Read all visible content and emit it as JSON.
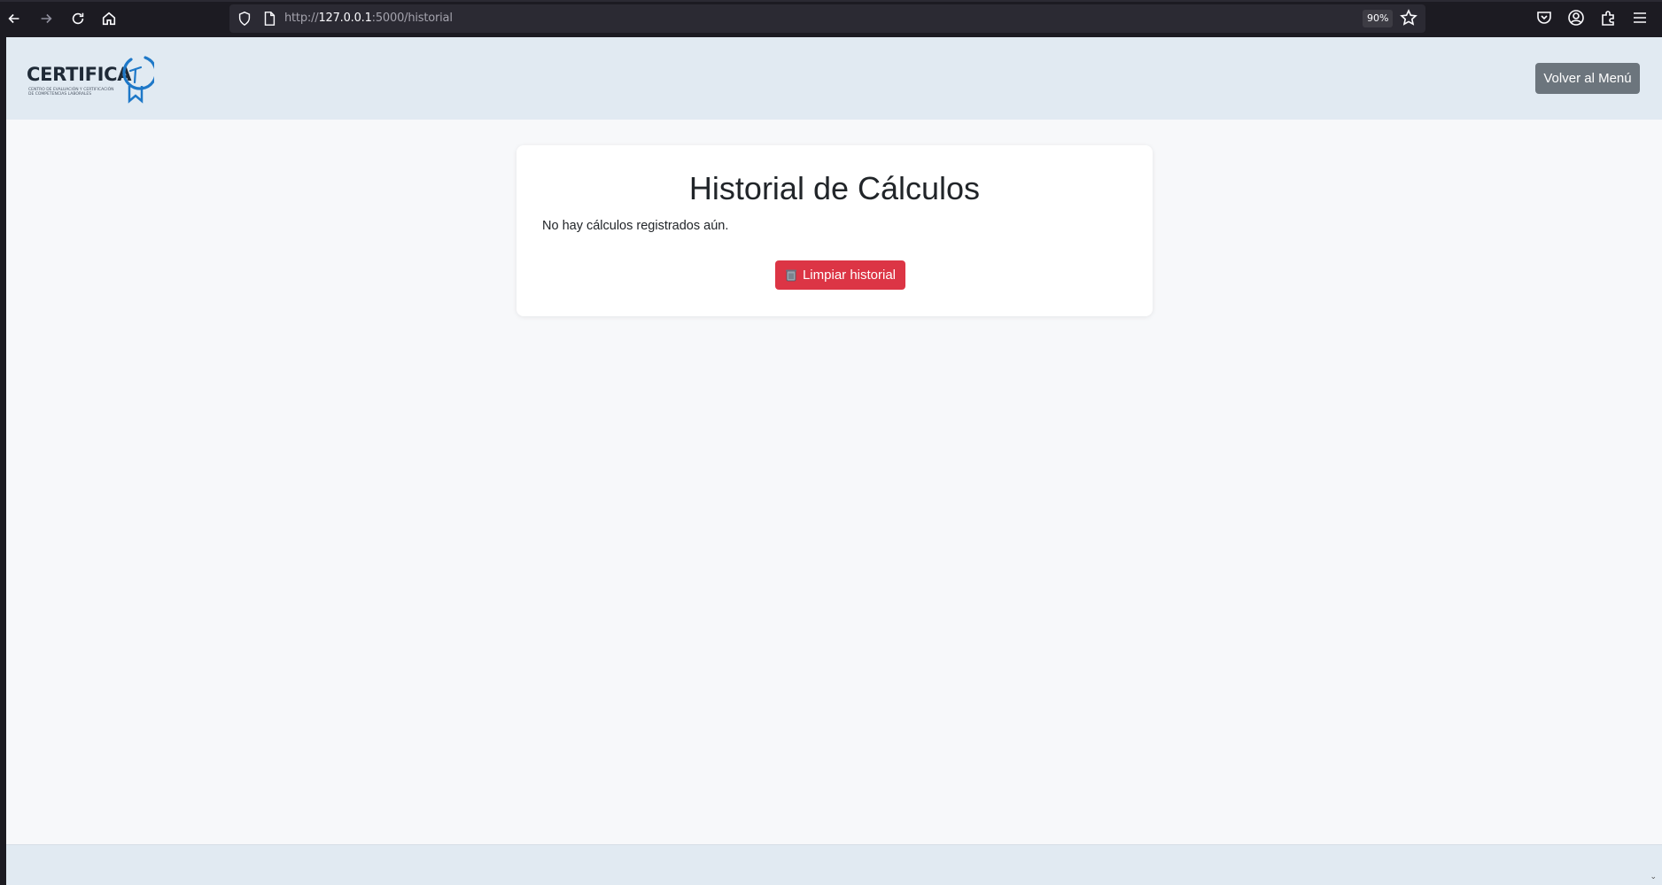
{
  "browser": {
    "url_scheme": "http://",
    "url_host": "127.0.0.1",
    "url_rest": ":5000/historial",
    "zoom": "90%"
  },
  "icons": {
    "back": "back-arrow-icon",
    "forward": "forward-arrow-icon",
    "reload": "reload-icon",
    "home": "home-icon",
    "shield": "shield-icon",
    "page": "page-icon",
    "bookmark": "star-icon",
    "pocket": "pocket-icon",
    "account": "account-icon",
    "extensions": "extensions-icon",
    "menu": "hamburger-menu-icon",
    "trash": "trash-icon"
  },
  "header": {
    "logo_word": "CERTIFICA",
    "logo_tagline": "CENTRO DE EVALUACIÓN Y CERTIFICACIÓN DE COMPETENCIAS LABORALES",
    "back_button": "Volver al Menú"
  },
  "main": {
    "title": "Historial de Cálculos",
    "empty_message": "No hay cálculos registrados aún.",
    "clear_button": "Limpiar historial"
  },
  "colors": {
    "header_bg": "#e1eaf2",
    "page_bg": "#f7f8fa",
    "danger": "#dc3545",
    "secondary": "#6c757d",
    "logo_accent": "#1e78c8"
  }
}
